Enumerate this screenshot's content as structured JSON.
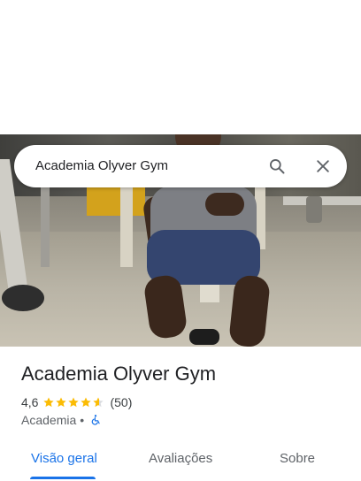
{
  "search": {
    "query": "Academia Olyver Gym",
    "search_icon": "search-icon",
    "close_icon": "close-icon"
  },
  "place": {
    "title": "Academia Olyver Gym",
    "rating": "4,6",
    "rating_value": 4.6,
    "stars_max": 5,
    "review_count": "(50)",
    "category": "Academia",
    "separator": "•",
    "accessibility_icon": "wheelchair-icon"
  },
  "tabs": [
    {
      "label": "Visão geral",
      "selected": true
    },
    {
      "label": "Avaliações",
      "selected": false
    },
    {
      "label": "Sobre",
      "selected": false
    }
  ],
  "colors": {
    "accent": "#1a73e8",
    "star": "#fbbc04",
    "star_empty": "#dadce0",
    "text_primary": "#202124",
    "text_secondary": "#5f6368"
  }
}
